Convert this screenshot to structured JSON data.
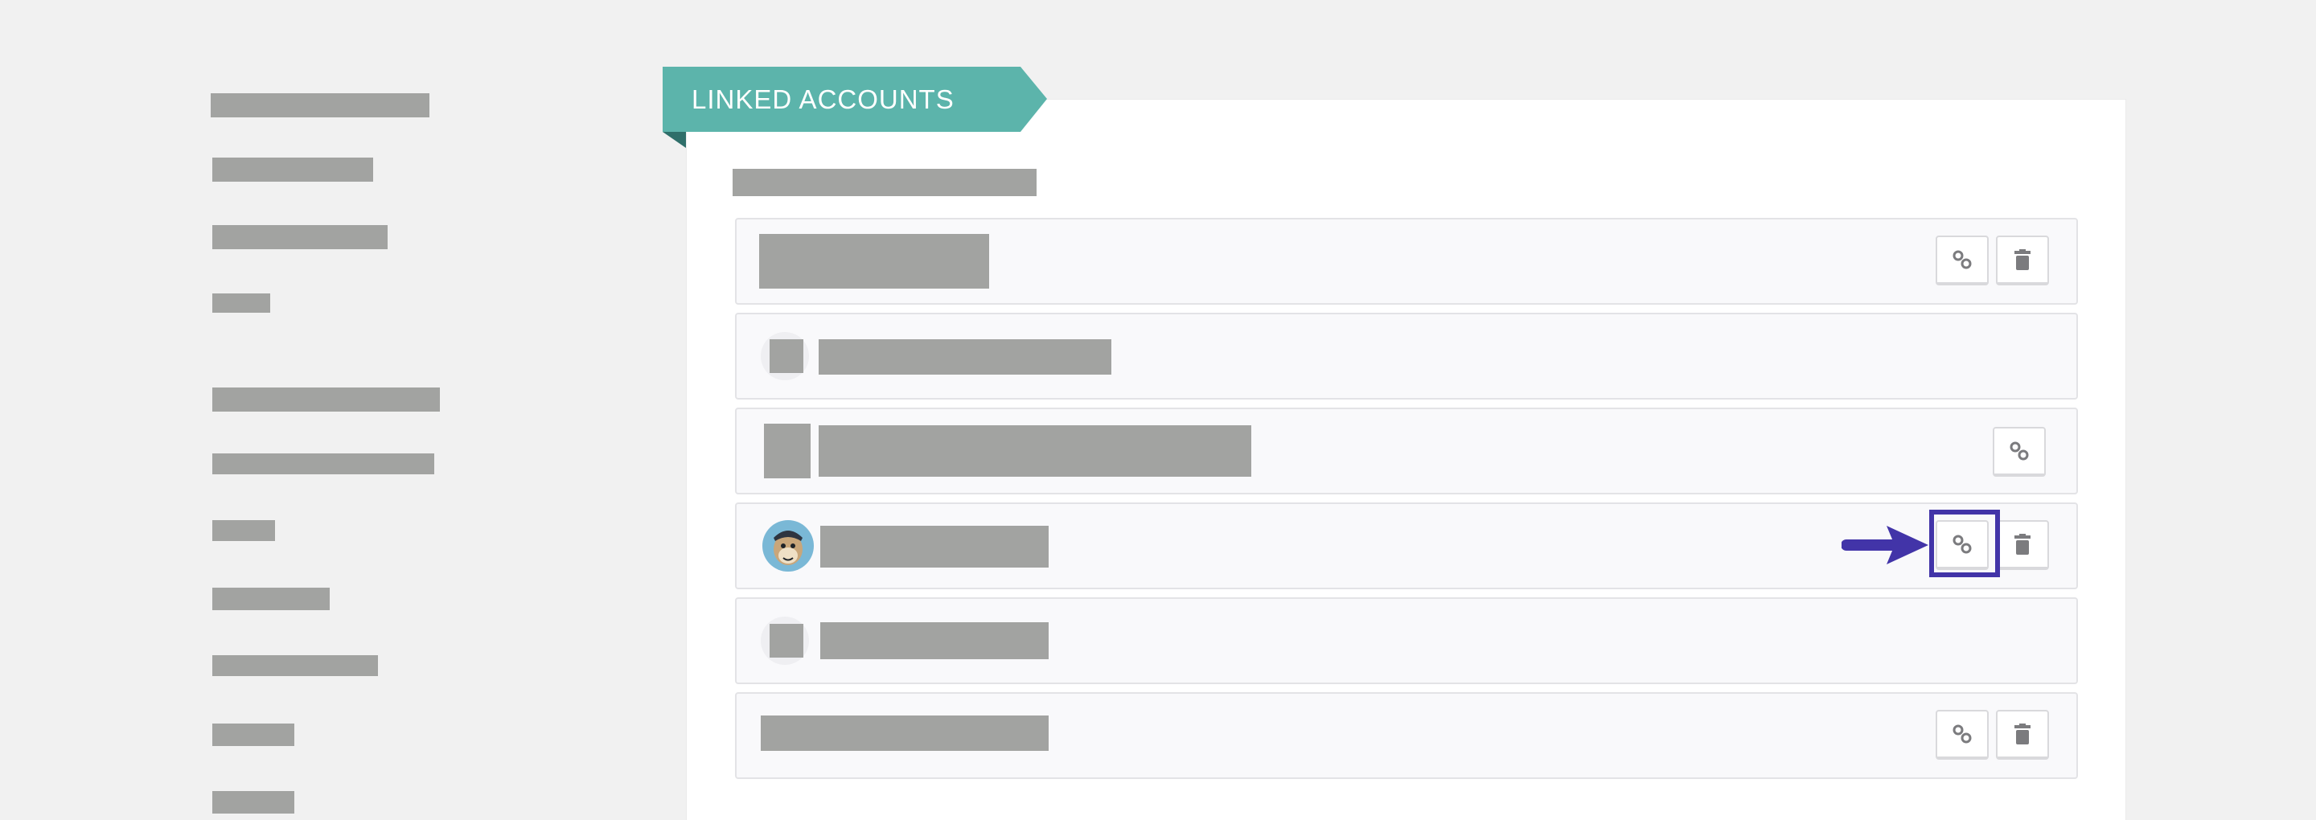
{
  "main": {
    "section_title": "LINKED ACCOUNTS"
  },
  "icons": {
    "link": "link-icon",
    "delete": "trash-icon",
    "account_avatar": "mailchimp-monkey-avatar"
  },
  "accounts": [
    {
      "has_avatar": false,
      "actions": [
        "link",
        "delete"
      ]
    },
    {
      "has_avatar": false,
      "actions": []
    },
    {
      "has_avatar": false,
      "actions": [
        "link"
      ]
    },
    {
      "has_avatar": true,
      "avatar": "mailchimp-monkey-avatar",
      "actions": [
        "link",
        "delete"
      ],
      "highlighted_action": "link"
    },
    {
      "has_avatar": false,
      "actions": []
    },
    {
      "has_avatar": false,
      "actions": [
        "link",
        "delete"
      ]
    }
  ],
  "colors": {
    "ribbon": "#5cb4ab",
    "annotation": "#4234a8",
    "placeholder": "#a2a3a1"
  }
}
